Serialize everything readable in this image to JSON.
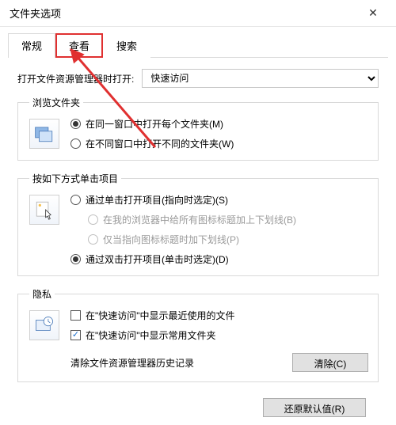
{
  "window": {
    "title": "文件夹选项"
  },
  "tabs": {
    "general": "常规",
    "view": "查看",
    "search": "搜索"
  },
  "open": {
    "label": "打开文件资源管理器时打开:",
    "selected": "快速访问"
  },
  "browse": {
    "legend": "浏览文件夹",
    "same_window": "在同一窗口中打开每个文件夹(M)",
    "new_window": "在不同窗口中打开不同的文件夹(W)"
  },
  "click": {
    "legend": "按如下方式单击项目",
    "single": "通过单击打开项目(指向时选定)(S)",
    "underline_all": "在我的浏览器中给所有图标标题加上下划线(B)",
    "underline_point": "仅当指向图标标题时加下划线(P)",
    "double": "通过双击打开项目(单击时选定)(D)"
  },
  "privacy": {
    "legend": "隐私",
    "recent_files": "在\"快速访问\"中显示最近使用的文件",
    "frequent_folders": "在\"快速访问\"中显示常用文件夹",
    "clear_label": "清除文件资源管理器历史记录",
    "clear_btn": "清除(C)"
  },
  "footer": {
    "restore": "还原默认值(R)"
  }
}
